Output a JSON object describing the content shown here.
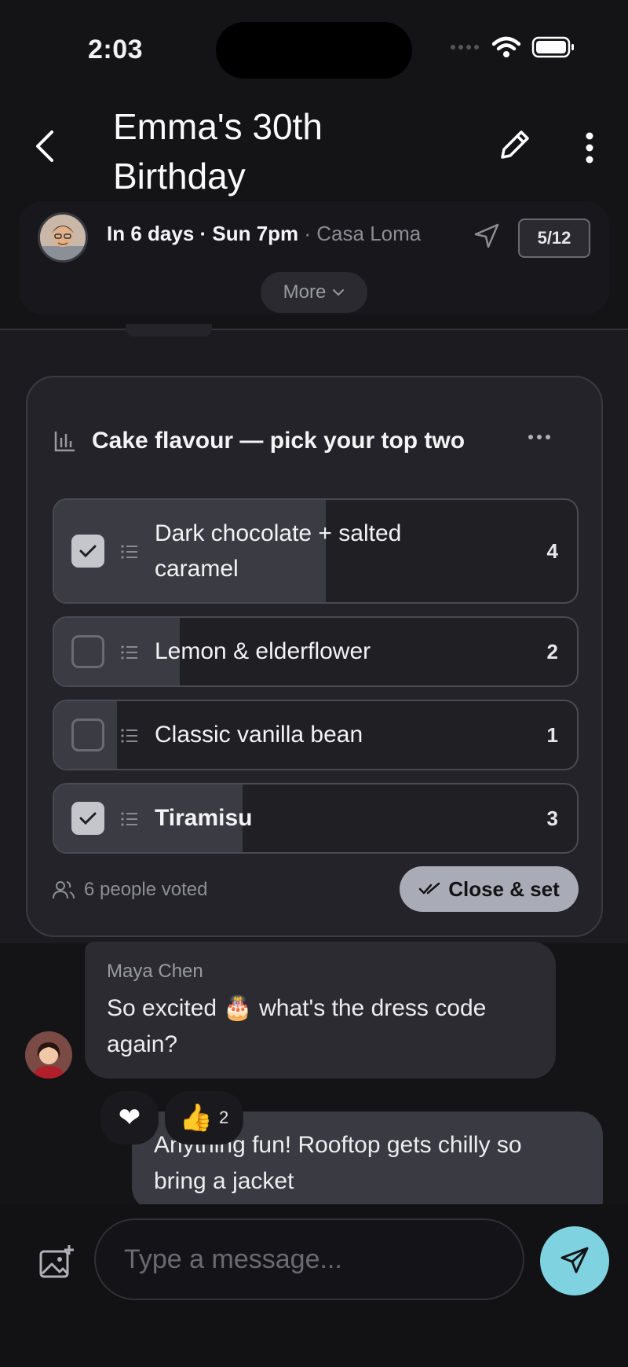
{
  "status_bar": {
    "time": "2:03"
  },
  "header": {
    "title": "Emma's 30th Birthday"
  },
  "event": {
    "when": "In 6 days · Sun 7pm",
    "separator": " · ",
    "venue": "Casa Loma",
    "counter": "5/12",
    "more_label": "More"
  },
  "poll": {
    "title": "Cake flavour — pick your top two",
    "options": [
      {
        "label": "Dark chocolate + salted caramel",
        "votes": "4",
        "checked": true,
        "share": 0.52
      },
      {
        "label": "Lemon & elderflower",
        "votes": "2",
        "checked": false,
        "share": 0.24
      },
      {
        "label": "Classic vanilla bean",
        "votes": "1",
        "checked": false,
        "share": 0.12
      },
      {
        "label": "Tiramisu",
        "votes": "3",
        "checked": true,
        "share": 0.36
      }
    ],
    "voted_text": "6 people voted",
    "close_label": "Close & set"
  },
  "messages": {
    "incoming": {
      "sender": "Maya Chen",
      "text": "So excited 🎂  what's the dress code again?"
    },
    "reactions": {
      "heart": "❤",
      "thumbs": "👍",
      "thumbs_count": "2"
    },
    "outgoing": {
      "text": "Anything fun! Rooftop gets chilly so bring a jacket"
    }
  },
  "composer": {
    "placeholder": "Type a message..."
  },
  "colors": {
    "accent": "#7fd3e0",
    "card": "#232329",
    "bar": "#3b3b43"
  }
}
